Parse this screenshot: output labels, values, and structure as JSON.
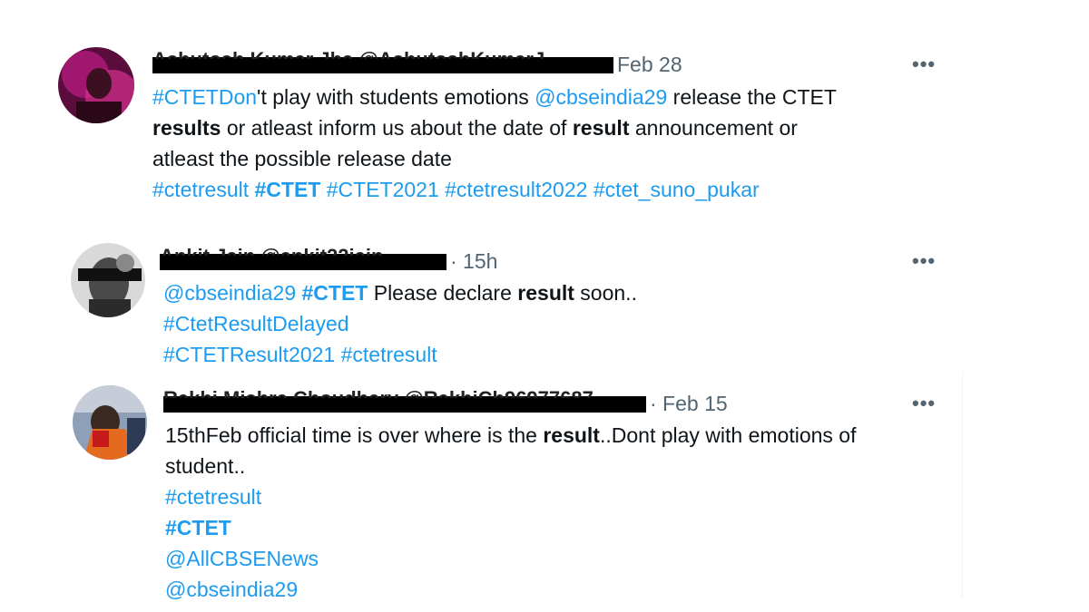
{
  "tweets": [
    {
      "time_label": "Feb 28",
      "more_icon": "more-horizontal-icon",
      "lines": [
        [
          {
            "t": "#CTETDon",
            "k": "tag"
          },
          {
            "t": "'t play with students emotions ",
            "k": "txt"
          },
          {
            "t": "@cbseindia29",
            "k": "tag"
          },
          {
            "t": "  release the CTET",
            "k": "txt"
          }
        ],
        [
          {
            "t": "results",
            "k": "bold"
          },
          {
            "t": " or atleast inform us about the date of ",
            "k": "txt"
          },
          {
            "t": "result",
            "k": "bold"
          },
          {
            "t": " announcement or",
            "k": "txt"
          }
        ],
        [
          {
            "t": "atleast the possible release date",
            "k": "txt"
          }
        ],
        [
          {
            "t": "#ctetresult",
            "k": "tag"
          },
          {
            "t": " ",
            "k": "txt"
          },
          {
            "t": "#CTET",
            "k": "tagb"
          },
          {
            "t": " ",
            "k": "txt"
          },
          {
            "t": "#CTET2021",
            "k": "tag"
          },
          {
            "t": "  ",
            "k": "txt"
          },
          {
            "t": "#ctetresult2022",
            "k": "tag"
          },
          {
            "t": "   ",
            "k": "txt"
          },
          {
            "t": "#ctet_suno_pukar",
            "k": "tag"
          }
        ]
      ]
    },
    {
      "time_label": "· 15h",
      "more_icon": "more-horizontal-icon",
      "lines": [
        [
          {
            "t": "@cbseindia29",
            "k": "tag"
          },
          {
            "t": " ",
            "k": "txt"
          },
          {
            "t": "#CTET",
            "k": "tagb"
          },
          {
            "t": "  Please declare ",
            "k": "txt"
          },
          {
            "t": "result",
            "k": "bold"
          },
          {
            "t": " soon..",
            "k": "txt"
          }
        ],
        [
          {
            "t": "#CtetResultDelayed",
            "k": "tag"
          }
        ],
        [
          {
            "t": "#CTETResult2021",
            "k": "tag"
          },
          {
            "t": " ",
            "k": "txt"
          },
          {
            "t": "#ctetresult",
            "k": "tag"
          }
        ]
      ]
    },
    {
      "time_label": "· Feb 15",
      "more_icon": "more-horizontal-icon",
      "lines": [
        [
          {
            "t": "15thFeb official time is over where is the ",
            "k": "txt"
          },
          {
            "t": "result",
            "k": "bold"
          },
          {
            "t": "..Dont play with emotions of",
            "k": "txt"
          }
        ],
        [
          {
            "t": "student..",
            "k": "txt"
          }
        ],
        [
          {
            "t": "#ctetresult",
            "k": "tag"
          }
        ],
        [
          {
            "t": "#CTET",
            "k": "tagb"
          }
        ],
        [
          {
            "t": "@AllCBSENews",
            "k": "tag"
          }
        ],
        [
          {
            "t": "@cbseindia29",
            "k": "tag"
          }
        ]
      ]
    }
  ],
  "colors": {
    "link": "#1d9bf0",
    "text": "#0f1419",
    "muted": "#536471"
  }
}
